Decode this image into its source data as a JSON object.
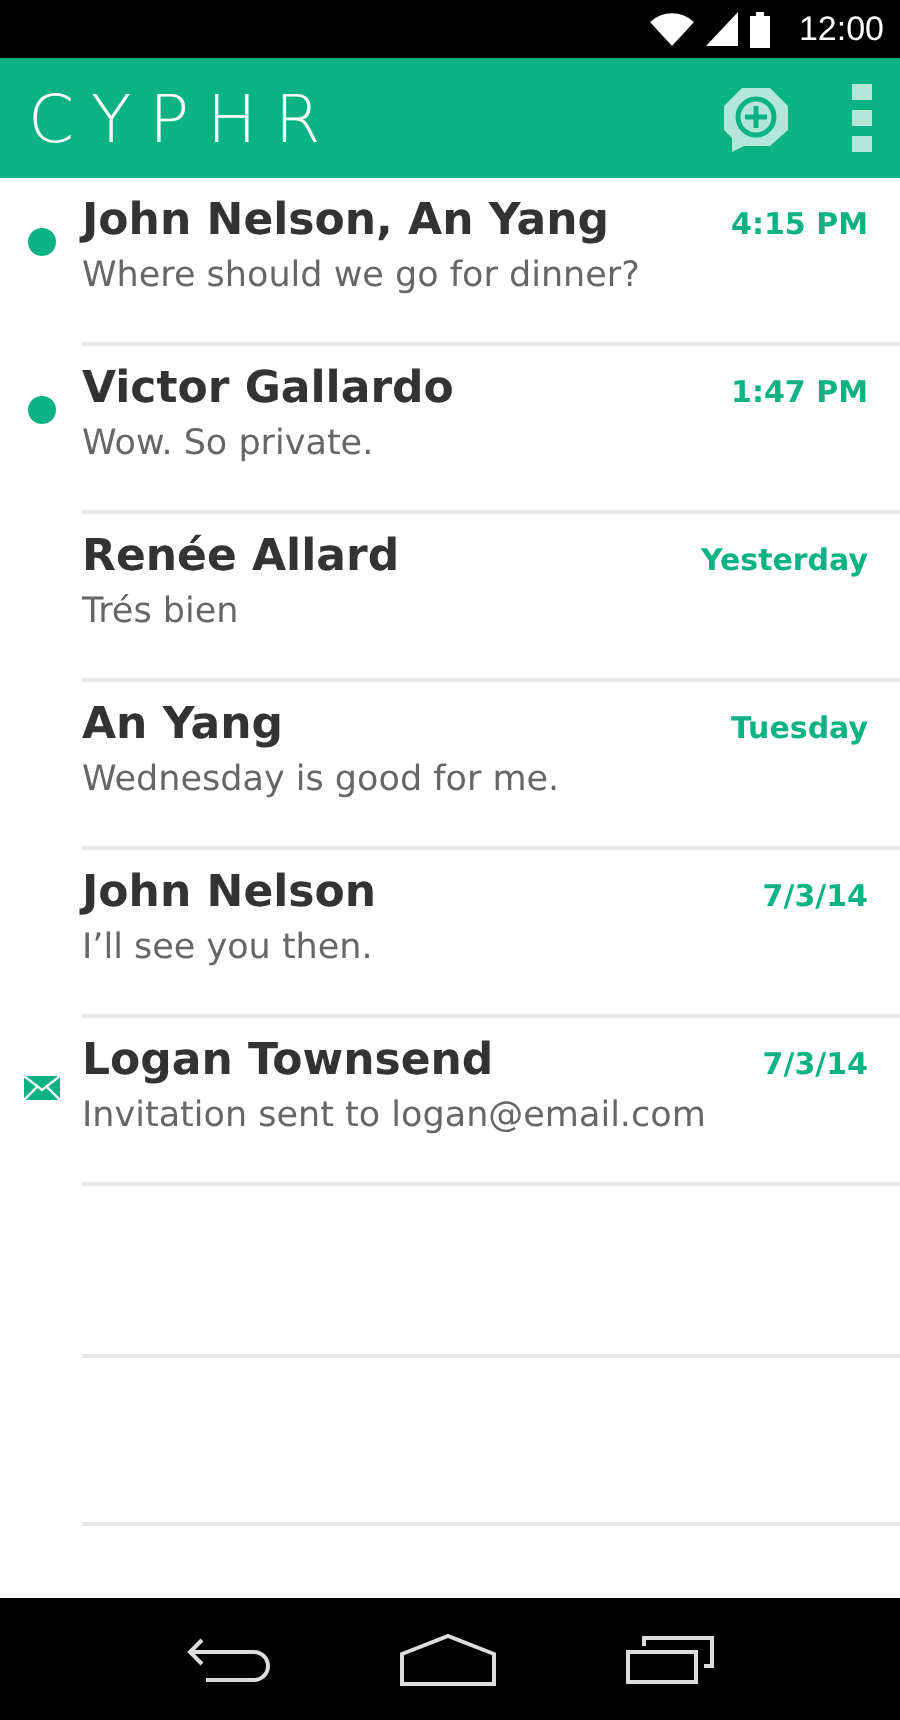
{
  "status_bar": {
    "time": "12:00"
  },
  "app_bar": {
    "title": "CYPHR"
  },
  "conversations": [
    {
      "name": "John Nelson, An Yang",
      "time": "4:15 PM",
      "preview": "Where should we go for dinner?",
      "unread": true,
      "kind": "chat"
    },
    {
      "name": "Victor Gallardo",
      "time": "1:47 PM",
      "preview": "Wow. So private.",
      "unread": true,
      "kind": "chat"
    },
    {
      "name": "Renée Allard",
      "time": "Yesterday",
      "preview": "Trés bien",
      "unread": false,
      "kind": "chat"
    },
    {
      "name": "An Yang",
      "time": "Tuesday",
      "preview": "Wednesday is good for me.",
      "unread": false,
      "kind": "chat"
    },
    {
      "name": "John Nelson",
      "time": "7/3/14",
      "preview": "I’ll see you then.",
      "unread": false,
      "kind": "chat"
    },
    {
      "name": "Logan Townsend",
      "time": "7/3/14",
      "preview": "Invitation sent to logan@email.com",
      "unread": false,
      "kind": "invite"
    }
  ]
}
